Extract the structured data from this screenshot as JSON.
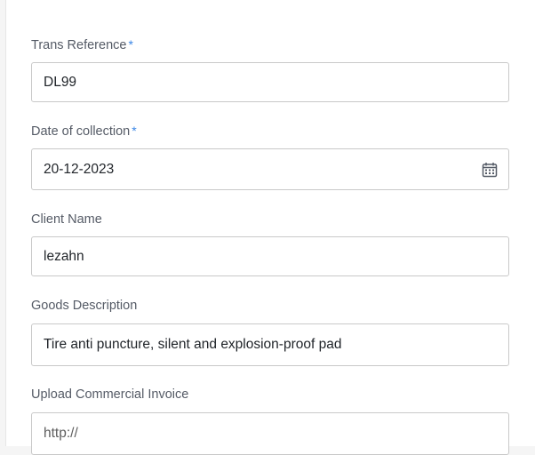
{
  "form": {
    "trans_reference": {
      "label": "Trans Reference",
      "required_mark": "*",
      "value": "DL99"
    },
    "date_of_collection": {
      "label": "Date of collection",
      "required_mark": "*",
      "value": "20-12-2023",
      "icon": "calendar-icon"
    },
    "client_name": {
      "label": "Client Name",
      "value": "lezahn"
    },
    "goods_description": {
      "label": "Goods Description",
      "value": "Tire anti puncture, silent and explosion-proof pad"
    },
    "upload_commercial_invoice": {
      "label": "Upload Commercial Invoice",
      "placeholder": "http://"
    }
  },
  "colors": {
    "required_asterisk": "#3a86e6",
    "label_text": "#555b66",
    "input_border": "#c9c9c9"
  }
}
